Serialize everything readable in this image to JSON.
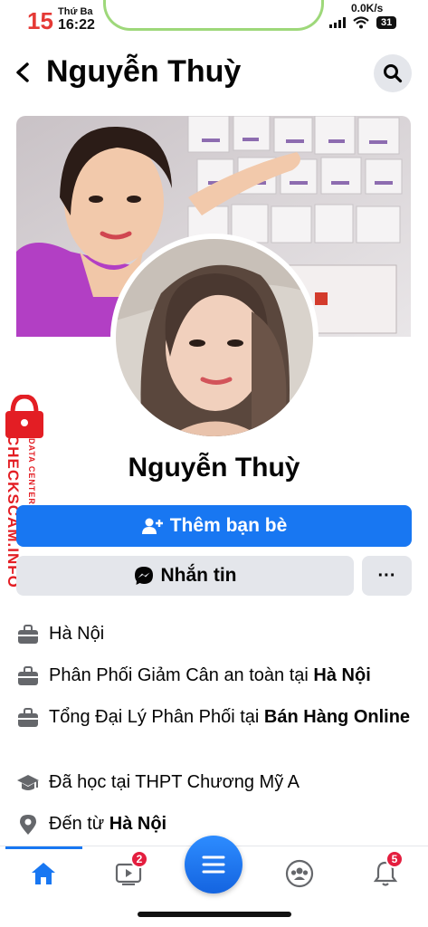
{
  "status_bar": {
    "date": "15",
    "weekday": "Thứ Ba",
    "time": "16:22",
    "network_speed": "0.0K/s",
    "battery": "31"
  },
  "header": {
    "title": "Nguyễn Thuỳ"
  },
  "profile": {
    "name": "Nguyễn Thuỳ"
  },
  "actions": {
    "add_friend_label": "Thêm bạn bè",
    "message_label": "Nhắn tin",
    "more_label": "···"
  },
  "details": [
    {
      "icon": "briefcase-icon",
      "text": "Hà Nội",
      "bold": ""
    },
    {
      "icon": "briefcase-icon",
      "text": "Phân Phối Giảm Cân an toàn tại ",
      "bold": "Hà Nội"
    },
    {
      "icon": "briefcase-icon",
      "text": "Tổng Đại Lý Phân Phối tại ",
      "bold": "Bán Hàng Online"
    },
    {
      "icon": "graduation-cap-icon",
      "text": "Đã học tại THPT Chương Mỹ A",
      "bold": ""
    },
    {
      "icon": "location-pin-icon",
      "text": "Đến từ ",
      "bold": "Hà Nội"
    }
  ],
  "watermark": {
    "brand": "CHECKSCAM.INFO",
    "sub": "DATA CENTER"
  },
  "bottom_nav": {
    "video_badge": "2",
    "notifications_badge": "5"
  },
  "colors": {
    "brand_blue": "#1877f2",
    "button_grey": "#e4e6eb",
    "badge_red": "#e41e3f",
    "watermark_red": "#e31e24"
  }
}
